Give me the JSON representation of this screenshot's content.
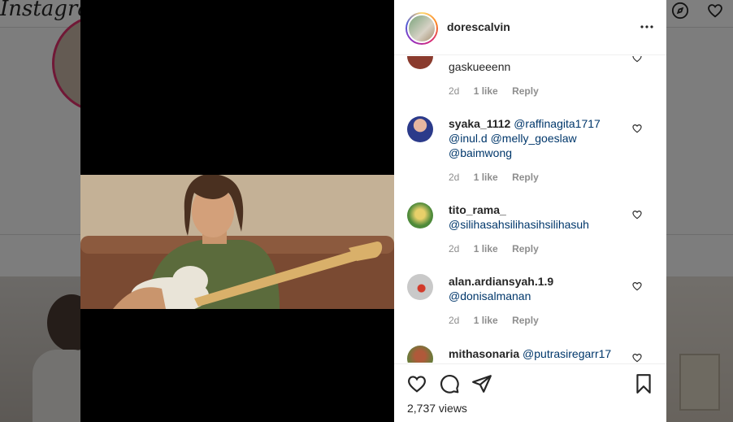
{
  "background": {
    "logo": "Instagram"
  },
  "post": {
    "username": "dorescalvin",
    "views": "2,737 views"
  },
  "comments": [
    {
      "user": "",
      "text": "gaskueeenn",
      "mentions": [],
      "time": "2d",
      "likes": "1 like",
      "reply": "Reply",
      "avatar_color": "#8a3b2e"
    },
    {
      "user": "syaka_1112",
      "text": "",
      "mentions": [
        "@raffinagita1717",
        "@inul.d",
        "@melly_goeslaw",
        "@baimwong"
      ],
      "time": "2d",
      "likes": "1 like",
      "reply": "Reply",
      "avatar_color": "#2b3a8a"
    },
    {
      "user": "tito_rama_",
      "text": "",
      "mentions": [
        "@silihasahsilihasihsilihasuh"
      ],
      "time": "2d",
      "likes": "1 like",
      "reply": "Reply",
      "avatar_color": "#4e8a3a"
    },
    {
      "user": "alan.ardiansyah.1.9",
      "text": "",
      "mentions": [
        "@donisalmanan"
      ],
      "time": "2d",
      "likes": "1 like",
      "reply": "Reply",
      "avatar_color": "#c9c9c9"
    },
    {
      "user": "mithasonaria",
      "text": "",
      "mentions": [
        "@putrasiregarr17"
      ],
      "time": "",
      "likes": "",
      "reply": "",
      "avatar_color": "#6b7a3a"
    }
  ],
  "icons": {
    "more": "more-options-icon",
    "like": "heart-icon",
    "comment": "comment-icon",
    "share": "share-icon",
    "save": "bookmark-icon"
  }
}
